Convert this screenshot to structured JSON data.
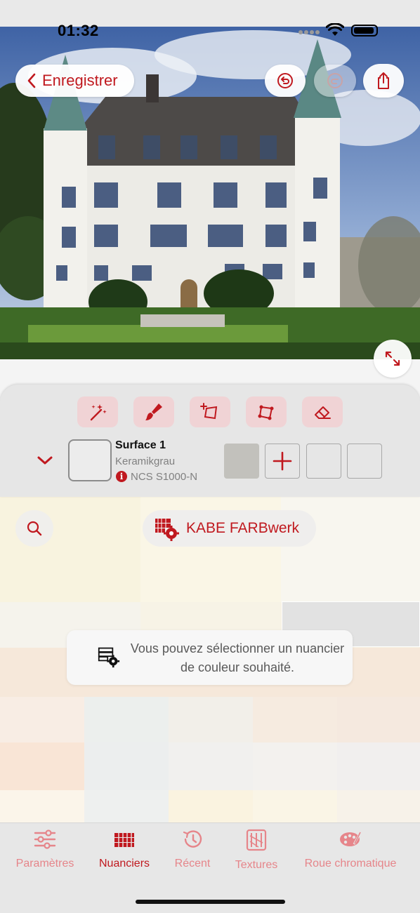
{
  "status": {
    "time": "01:32"
  },
  "header": {
    "back_label": "Enregistrer"
  },
  "icons": {
    "back": "chevron-left-icon",
    "undo": "undo-icon",
    "redo": "redo-icon",
    "share": "share-icon",
    "expand": "expand-icon"
  },
  "tools": [
    {
      "name": "magic-wand-icon"
    },
    {
      "name": "paint-brush-icon"
    },
    {
      "name": "polygon-add-icon"
    },
    {
      "name": "polygon-edit-icon"
    },
    {
      "name": "eraser-icon"
    }
  ],
  "surface": {
    "name": "Surface 1",
    "color_name": "Keramikgrau",
    "code": "NCS S1000-N",
    "info_glyph": "i",
    "selected_color": "#c2c1bc"
  },
  "palette": {
    "brand_label": "KABE FARBwerk",
    "toast_text": "Vous pouvez sélectionner un nuancier de couleur souhaité."
  },
  "tabs": [
    {
      "label": "Paramètres",
      "icon": "sliders-icon",
      "active": false
    },
    {
      "label": "Nuanciers",
      "icon": "color-fan-icon",
      "active": true
    },
    {
      "label": "Récent",
      "icon": "history-icon",
      "active": false
    },
    {
      "label": "Textures",
      "icon": "texture-icon",
      "active": false
    },
    {
      "label": "Roue chromatique",
      "icon": "color-wheel-icon",
      "active": false
    }
  ],
  "colors": {
    "accent": "#c0191f",
    "accent_light": "#e6858a",
    "tool_bg": "#f0d3d5"
  }
}
